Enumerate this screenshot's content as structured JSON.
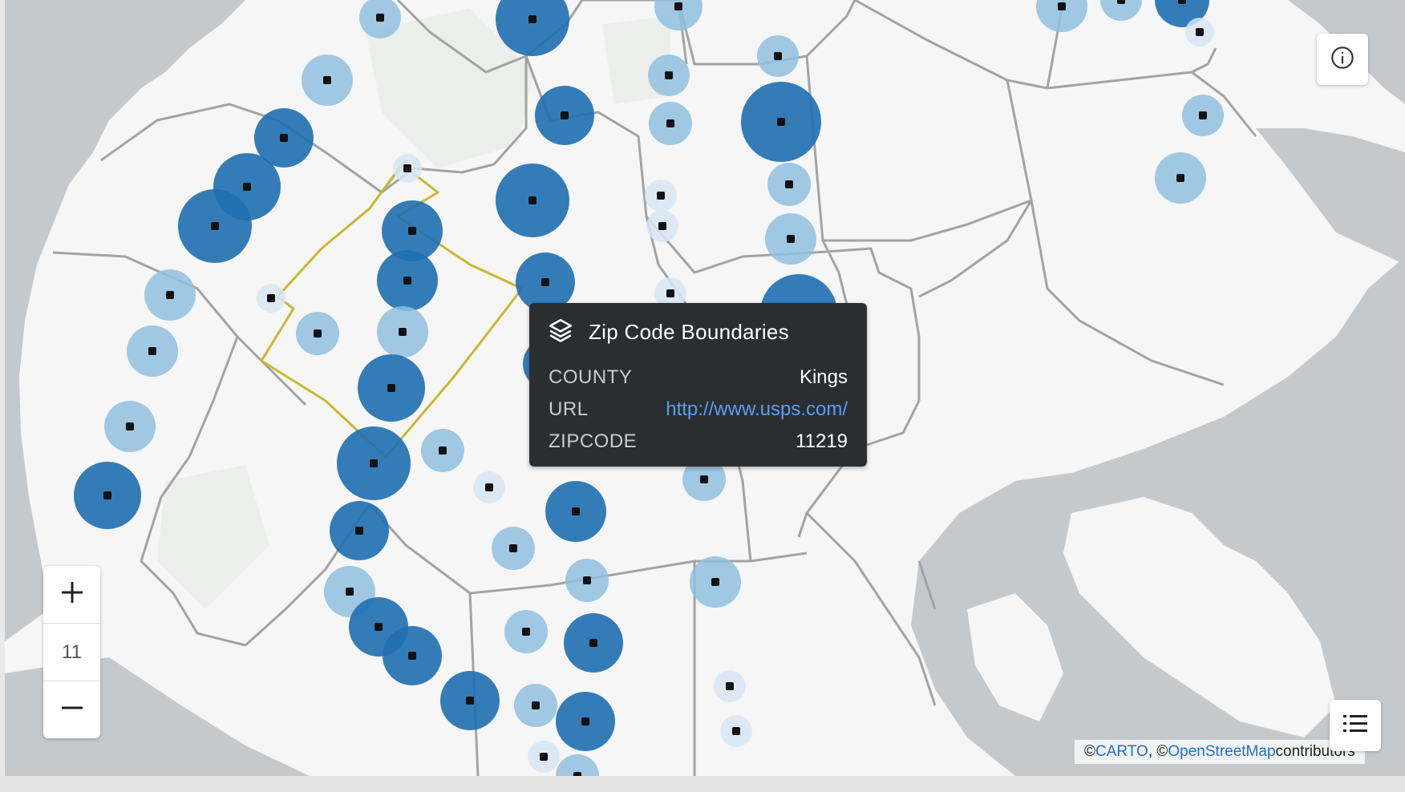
{
  "map": {
    "colors": {
      "land": "#f6f6f6",
      "water": "#c6c9cc",
      "boundary": "#a3a3a3",
      "highlight_boundary": "#c9b830",
      "point_dark": "#1f6fb1",
      "point_mid": "#90c0df",
      "point_light": "#d7e6f5",
      "point_center": "#111111"
    },
    "layer": "Zip Code Boundaries"
  },
  "tooltip": {
    "icon": "layers-icon",
    "title": "Zip Code Boundaries",
    "rows": [
      {
        "key": "COUNTY",
        "value": "Kings"
      },
      {
        "key": "URL",
        "value": "http://www.usps.com/"
      },
      {
        "key": "ZIPCODE",
        "value": "11219"
      }
    ]
  },
  "zoom_control": {
    "zoom_in_icon": "plus-icon",
    "zoom_out_icon": "minus-icon",
    "level": "11"
  },
  "info_button": {
    "icon": "info-icon"
  },
  "legend_button": {
    "icon": "list-icon"
  },
  "attribution": {
    "prefix_1": "© ",
    "carto": "CARTO",
    "sep": ", © ",
    "osm": "OpenStreetMap",
    "suffix": " contributors"
  }
}
